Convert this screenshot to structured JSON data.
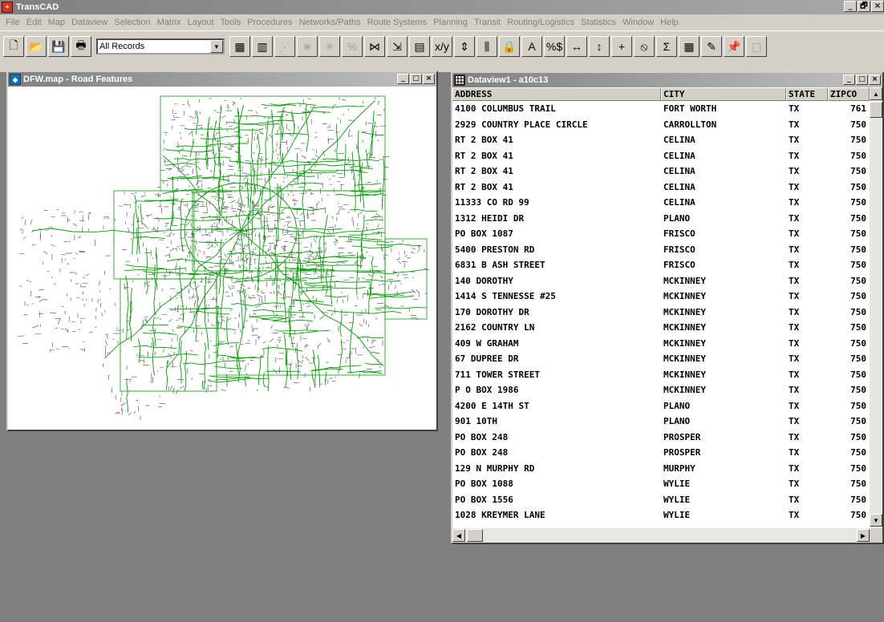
{
  "app": {
    "title": "TransCAD",
    "icon": "transcad-logo-icon"
  },
  "window_controls": {
    "minimize": "_",
    "restore": "🗗",
    "close": "×"
  },
  "menu": [
    "File",
    "Edit",
    "Map",
    "Dataview",
    "Selection",
    "Matrix",
    "Layout",
    "Tools",
    "Procedures",
    "Networks/Paths",
    "Route Systems",
    "Planning",
    "Transit",
    "Routing/Logistics",
    "Statistics",
    "Window",
    "Help"
  ],
  "toolbar": {
    "selection_value": "All Records",
    "buttons_left": [
      {
        "name": "new-file-icon",
        "glyph": "🗋"
      },
      {
        "name": "open-folder-icon",
        "glyph": "📂"
      },
      {
        "name": "save-icon",
        "glyph": "💾"
      },
      {
        "name": "print-icon",
        "glyph": "🖶"
      }
    ],
    "buttons_right": [
      {
        "name": "dataview-icon",
        "glyph": "▦"
      },
      {
        "name": "chart-icon",
        "glyph": "▥"
      },
      {
        "name": "network-disabled-icon",
        "glyph": "⋰"
      },
      {
        "name": "pattern-disabled-icon",
        "glyph": "⋇"
      },
      {
        "name": "star-disabled-icon",
        "glyph": "✳"
      },
      {
        "name": "merge-disabled-icon",
        "glyph": "%"
      },
      {
        "name": "split-icon",
        "glyph": "⋈"
      },
      {
        "name": "arrows-icon",
        "glyph": "⇲"
      },
      {
        "name": "table-edit-icon",
        "glyph": "▤"
      },
      {
        "name": "formula-icon",
        "glyph": "x/y"
      },
      {
        "name": "fill-icon",
        "glyph": "⇕"
      },
      {
        "name": "columns-icon",
        "glyph": "⫼"
      },
      {
        "name": "lock-icon",
        "glyph": "🔒"
      },
      {
        "name": "text-icon",
        "glyph": "A"
      },
      {
        "name": "stats-icon",
        "glyph": "%$"
      },
      {
        "name": "expand-horizontal-icon",
        "glyph": "↔"
      },
      {
        "name": "expand-vertical-icon",
        "glyph": "↕"
      },
      {
        "name": "add-icon",
        "glyph": "+"
      },
      {
        "name": "no-entry-icon",
        "glyph": "⦸"
      },
      {
        "name": "sum-icon",
        "glyph": "Σ"
      },
      {
        "name": "grid-icon",
        "glyph": "▦"
      },
      {
        "name": "map-edit-icon",
        "glyph": "✎"
      },
      {
        "name": "pin-icon",
        "glyph": "📌"
      },
      {
        "name": "frame-disabled-icon",
        "glyph": "▢"
      }
    ]
  },
  "map_window": {
    "title": "DFW.map - Road Features",
    "colors": {
      "roads": "#606060",
      "highways": "#00a000",
      "boundary": "#00a000"
    }
  },
  "dataview_window": {
    "title": "Dataview1 - a10c13",
    "columns": [
      "ADDRESS",
      "CITY",
      "STATE",
      "ZIPCO"
    ],
    "rows": [
      [
        "4100 COLUMBUS TRAIL",
        "FORT WORTH",
        "TX",
        "761"
      ],
      [
        "2929 COUNTRY PLACE CIRCLE",
        "CARROLLTON",
        "TX",
        "750"
      ],
      [
        "RT 2 BOX 41",
        "CELINA",
        "TX",
        "750"
      ],
      [
        "RT 2 BOX 41",
        "CELINA",
        "TX",
        "750"
      ],
      [
        "RT 2 BOX 41",
        "CELINA",
        "TX",
        "750"
      ],
      [
        "RT 2 BOX 41",
        "CELINA",
        "TX",
        "750"
      ],
      [
        "11333 CO RD 99",
        "CELINA",
        "TX",
        "750"
      ],
      [
        "1312 HEIDI DR",
        "PLANO",
        "TX",
        "750"
      ],
      [
        "PO BOX 1087",
        "FRISCO",
        "TX",
        "750"
      ],
      [
        "5400 PRESTON RD",
        "FRISCO",
        "TX",
        "750"
      ],
      [
        "6831 B ASH STREET",
        "FRISCO",
        "TX",
        "750"
      ],
      [
        "140 DOROTHY",
        "MCKINNEY",
        "TX",
        "750"
      ],
      [
        "1414 S TENNESSE #25",
        "MCKINNEY",
        "TX",
        "750"
      ],
      [
        "170 DOROTHY DR",
        "MCKINNEY",
        "TX",
        "750"
      ],
      [
        "2162 COUNTRY LN",
        "MCKINNEY",
        "TX",
        "750"
      ],
      [
        "409 W GRAHAM",
        "MCKINNEY",
        "TX",
        "750"
      ],
      [
        "67 DUPREE DR",
        "MCKINNEY",
        "TX",
        "750"
      ],
      [
        "711 TOWER STREET",
        "MCKINNEY",
        "TX",
        "750"
      ],
      [
        "P O BOX 1986",
        "MCKINNEY",
        "TX",
        "750"
      ],
      [
        "4200 E 14TH ST",
        "PLANO",
        "TX",
        "750"
      ],
      [
        "901 10TH",
        "PLANO",
        "TX",
        "750"
      ],
      [
        "PO BOX 248",
        "PROSPER",
        "TX",
        "750"
      ],
      [
        "PO BOX 248",
        "PROSPER",
        "TX",
        "750"
      ],
      [
        "129 N MURPHY RD",
        "MURPHY",
        "TX",
        "750"
      ],
      [
        "PO BOX 1088",
        "WYLIE",
        "TX",
        "750"
      ],
      [
        "PO BOX 1556",
        "WYLIE",
        "TX",
        "750"
      ],
      [
        "1028 KREYMER LANE",
        "WYLIE",
        "TX",
        "750"
      ]
    ]
  }
}
